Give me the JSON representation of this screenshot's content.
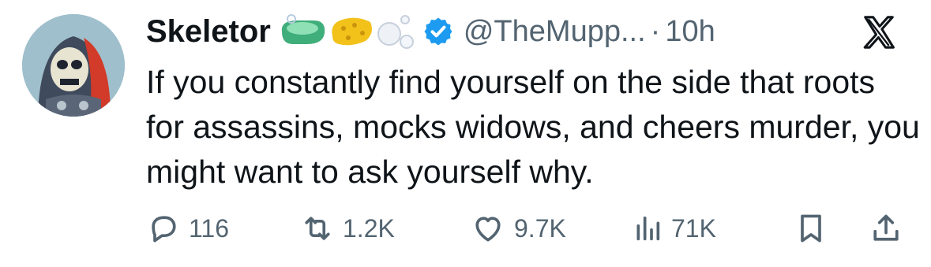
{
  "tweet": {
    "author_name": "Skeletor",
    "handle": "@TheMupp...",
    "separator": "·",
    "time": "10h",
    "text": "If you constantly find yourself on the side that roots for assassins, mocks widows, and cheers murder, you might want to ask yourself why."
  },
  "name_emojis": [
    "soap-icon",
    "sponge-icon",
    "bubbles-icon"
  ],
  "verified_badge_color": "#1d9bf0",
  "actions": {
    "replies": "116",
    "reposts": "1.2K",
    "likes": "9.7K",
    "views": "71K"
  },
  "colors": {
    "text_primary": "#0f1419",
    "text_secondary": "#536471",
    "verified": "#1d9bf0"
  },
  "icons": {
    "platform_logo": "x-logo-icon",
    "reply": "reply-icon",
    "repost": "repost-icon",
    "like": "heart-icon",
    "views": "views-icon",
    "bookmark": "bookmark-icon",
    "share": "share-icon"
  }
}
